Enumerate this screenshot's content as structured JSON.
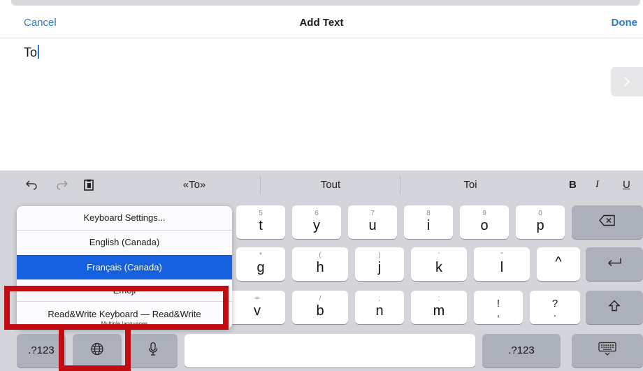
{
  "navbar": {
    "cancel_label": "Cancel",
    "title": "Add Text",
    "done_label": "Done"
  },
  "editor": {
    "text": "To"
  },
  "predictive": {
    "suggestions": [
      "«To»",
      "Tout",
      "Toi"
    ],
    "format": {
      "bold": "B",
      "italic": "I",
      "underline": "U"
    }
  },
  "keys": {
    "row1": [
      {
        "hint": "5",
        "char": "t"
      },
      {
        "hint": "6",
        "char": "y"
      },
      {
        "hint": "7",
        "char": "u"
      },
      {
        "hint": "8",
        "char": "i"
      },
      {
        "hint": "9",
        "char": "o"
      },
      {
        "hint": "0",
        "char": "p"
      }
    ],
    "row2": [
      {
        "hint": "*",
        "char": "g"
      },
      {
        "hint": "(",
        "char": "h"
      },
      {
        "hint": ")",
        "char": "j"
      },
      {
        "hint": "'",
        "char": "k"
      },
      {
        "hint": "\"",
        "char": "l"
      },
      {
        "hint": "",
        "char": "^"
      }
    ],
    "row3": [
      {
        "hint": "=",
        "char": "v"
      },
      {
        "hint": "/",
        "char": "b"
      },
      {
        "hint": ";",
        "char": "n"
      },
      {
        "hint": ":",
        "char": "m"
      },
      {
        "hint": "!",
        "char": ","
      },
      {
        "hint": "?",
        "char": "."
      }
    ],
    "numbers_left": ".?123",
    "numbers_right": ".?123"
  },
  "language_menu": {
    "items": [
      "Keyboard Settings...",
      "English (Canada)",
      "Français (Canada)",
      "Emoji",
      "Read&Write Keyboard — Read&Write"
    ],
    "selected": "Français (Canada)",
    "subtitle": "Multiple languages"
  },
  "colors": {
    "accent": "#2e78c9",
    "selection": "#1560de",
    "highlight": "#c00c12"
  }
}
